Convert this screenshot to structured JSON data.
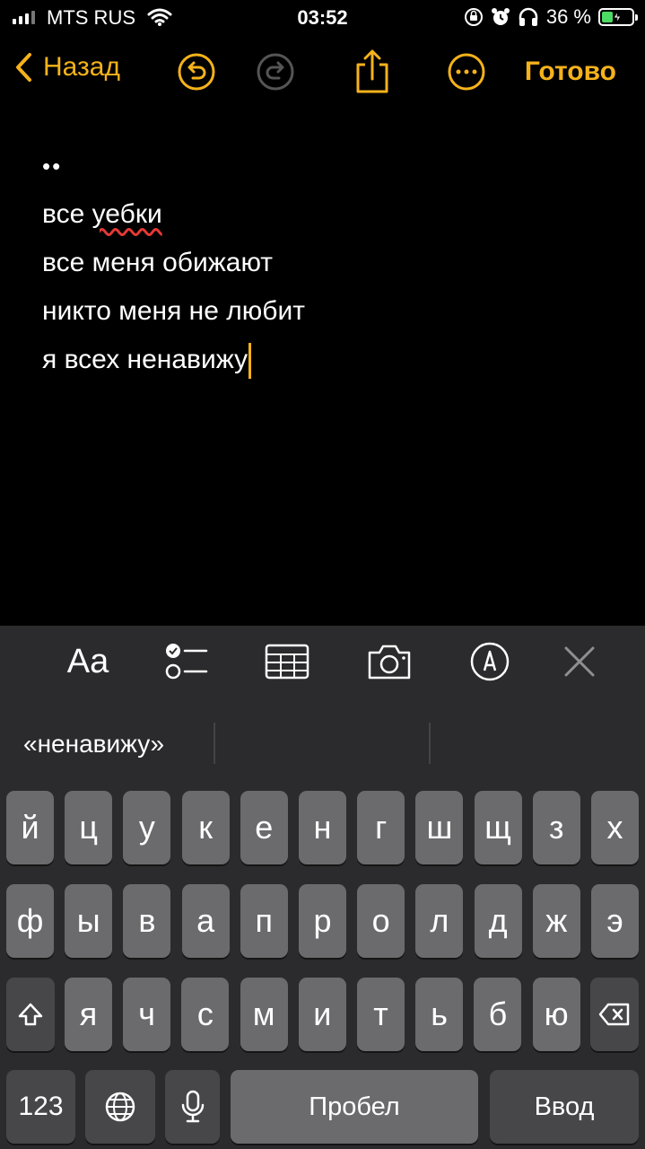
{
  "status_bar": {
    "carrier": "MTS RUS",
    "time": "03:52",
    "battery_percent": "36 %",
    "battery_level": 0.36,
    "icons": [
      "signal-icon",
      "wifi-icon",
      "rotation-lock-icon",
      "alarm-icon",
      "headphones-icon",
      "battery-icon"
    ]
  },
  "navbar": {
    "back_label": "Назад",
    "done_label": "Готово",
    "icons": [
      "undo-icon",
      "redo-icon",
      "share-icon",
      "more-icon"
    ],
    "accent": "#f5b21b"
  },
  "note": {
    "dots": "••",
    "lines": [
      "все уебки",
      "все меня обижают",
      "никто меня не любит",
      "я всех ненавижу"
    ],
    "line1_prefix": "все ",
    "line1_misspelled": "уебки"
  },
  "toolbar": {
    "format_label": "Aa",
    "icons": [
      "checklist-icon",
      "table-icon",
      "camera-icon",
      "markup-icon",
      "close-icon"
    ]
  },
  "keyboard": {
    "suggestion": "«ненавижу»",
    "row1": [
      "й",
      "ц",
      "у",
      "к",
      "е",
      "н",
      "г",
      "ш",
      "щ",
      "з",
      "х"
    ],
    "row2": [
      "ф",
      "ы",
      "в",
      "а",
      "п",
      "р",
      "о",
      "л",
      "д",
      "ж",
      "э"
    ],
    "row3": [
      "я",
      "ч",
      "с",
      "м",
      "и",
      "т",
      "ь",
      "б",
      "ю"
    ],
    "numbers_label": "123",
    "space_label": "Пробел",
    "return_label": "Ввод"
  }
}
